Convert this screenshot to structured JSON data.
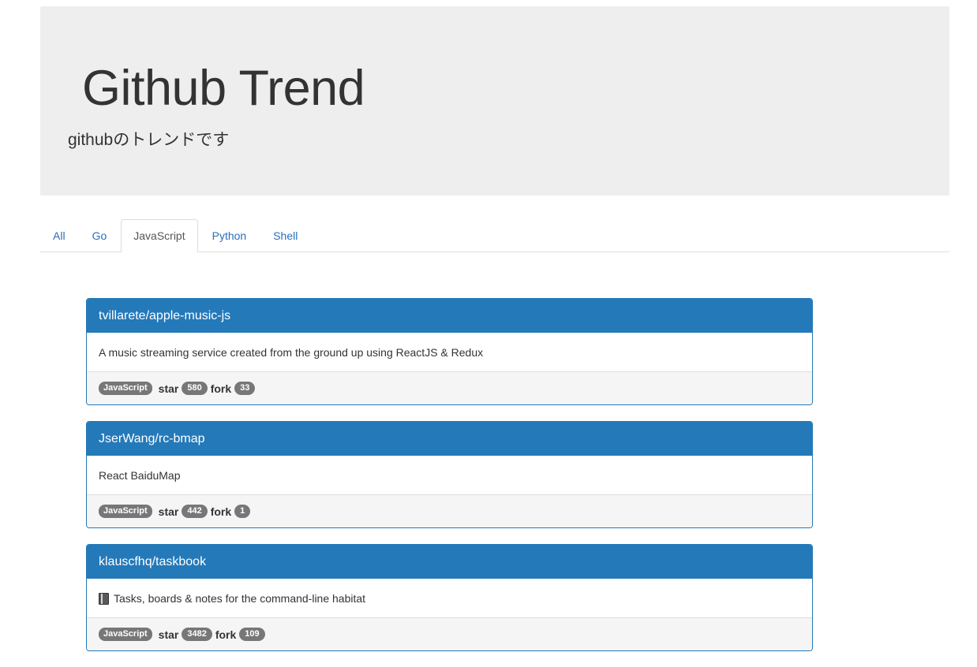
{
  "header": {
    "title": "Github Trend",
    "subtitle": "githubのトレンドです"
  },
  "tabs": [
    {
      "label": "All",
      "active": false
    },
    {
      "label": "Go",
      "active": false
    },
    {
      "label": "JavaScript",
      "active": true
    },
    {
      "label": "Python",
      "active": false
    },
    {
      "label": "Shell",
      "active": false
    }
  ],
  "stat_labels": {
    "star": "star",
    "fork": "fork"
  },
  "repos": [
    {
      "name": "tvillarete/apple-music-js",
      "description": "A music streaming service created from the ground up using ReactJS & Redux",
      "language": "JavaScript",
      "stars": "580",
      "forks": "33"
    },
    {
      "name": "JserWang/rc-bmap",
      "description": "React BaiduMap",
      "language": "JavaScript",
      "stars": "442",
      "forks": "1"
    },
    {
      "name": "klauscfhq/taskbook",
      "description": "Tasks, boards & notes for the command-line habitat",
      "description_icon": "notebook-icon",
      "language": "JavaScript",
      "stars": "3482",
      "forks": "109"
    }
  ],
  "colors": {
    "panel_primary": "#2479b9",
    "link": "#2a6ebb",
    "jumbotron_bg": "#eeeeee",
    "label_bg": "#777777"
  }
}
